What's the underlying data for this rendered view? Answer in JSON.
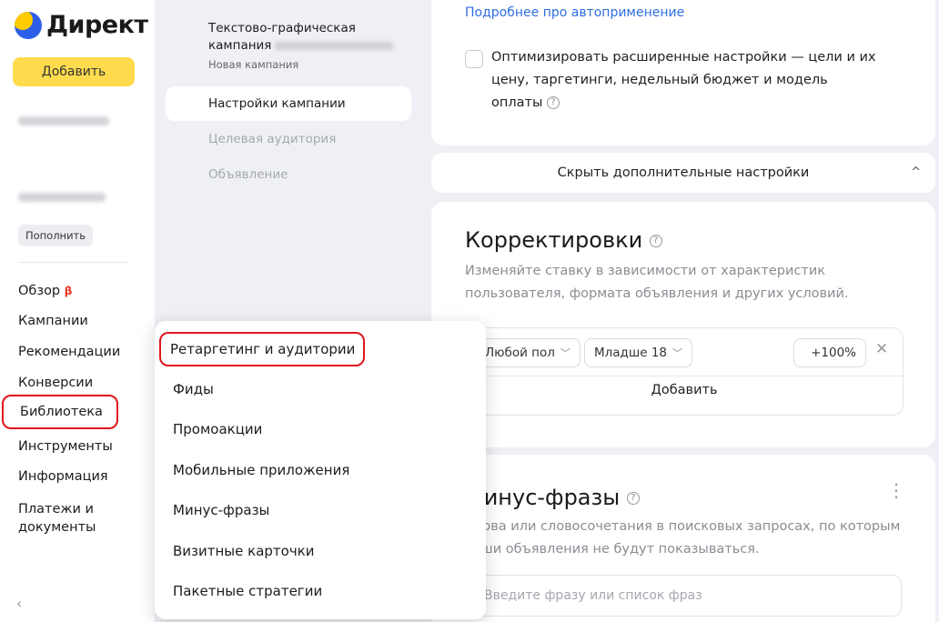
{
  "sidebar": {
    "logo_text": "Директ",
    "add_button": "Добавить",
    "topup_button": "Пополнить",
    "beta": "β",
    "nav": [
      {
        "label": "Обзор"
      },
      {
        "label": "Кампании"
      },
      {
        "label": "Рекомендации"
      },
      {
        "label": "Конверсии"
      },
      {
        "label": "Библиотека"
      },
      {
        "label": "Инструменты"
      },
      {
        "label": "Информация"
      },
      {
        "label": "Платежи и документы"
      }
    ],
    "collapse": "‹"
  },
  "campaign": {
    "title": "Текстово-графическая кампания",
    "subtitle": "Новая кампания",
    "steps": {
      "settings": "Настройки кампании",
      "audience": "Целевая аудитория",
      "ad": "Объявление"
    }
  },
  "content": {
    "auto_link": "Подробнее про автоприменение",
    "optimize_text": "Оптимизировать расширенные настройки — цели и их цену, таргетинги, недельный бюджет и модель оплаты",
    "help": "?",
    "hide_settings": "Скрыть дополнительные настройки",
    "hide_chevron": "^",
    "adjustments": {
      "title": "Корректировки",
      "desc": "Изменяйте ставку в зависимости от характеристик пользователя, формата объявления и других условий.",
      "gender": "Любой пол",
      "age": "Младше 18",
      "percent": "+100%",
      "close": "✕",
      "add": "Добавить"
    },
    "minus": {
      "title": "Минус-фразы",
      "desc": "Слова или словосочетания в поисковых запросах, по которым ваши объявления не будут показываться.",
      "more": "⋮",
      "placeholder": "Введите фразу или список фраз"
    }
  },
  "menu": {
    "items": [
      {
        "label": "Ретаргетинг и аудитории"
      },
      {
        "label": "Фиды"
      },
      {
        "label": "Промоакции"
      },
      {
        "label": "Мобильные приложения"
      },
      {
        "label": "Минус-фразы"
      },
      {
        "label": "Визитные карточки"
      },
      {
        "label": "Пакетные стратегии"
      }
    ]
  }
}
